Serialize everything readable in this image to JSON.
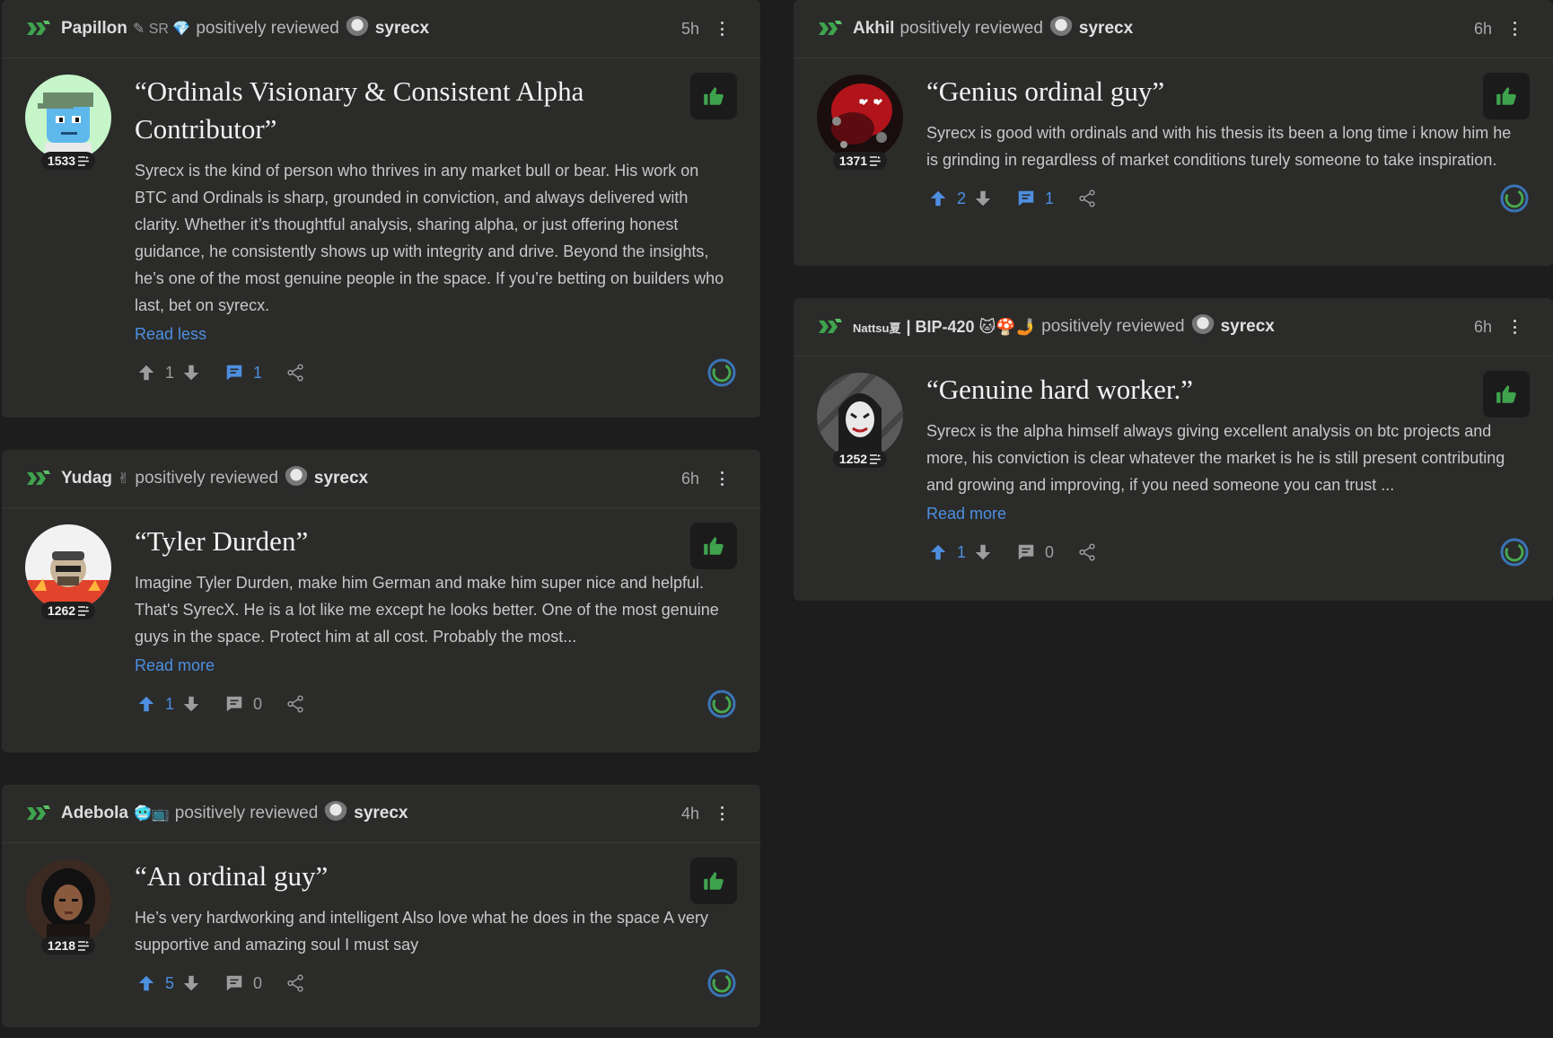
{
  "colors": {
    "page_bg": "#1d1d1d",
    "card_bg": "#2b2b2a",
    "accent_blue": "#4d8fe0",
    "thumb_green": "#3fa34d",
    "brand_green": "#3fa34d"
  },
  "reviews": [
    {
      "reviewer": "Papillon",
      "reviewer_extra": "✎ SR 💎",
      "verb": "positively reviewed",
      "target": "syrecx",
      "time": "5h",
      "score": "1533",
      "title": "“Ordinals Visionary & Consistent Alpha Contributor”",
      "text": "Syrecx is the kind of person who thrives in any market bull or bear. His work on BTC and Ordinals is sharp, grounded in conviction, and always delivered with clarity. Whether it’s thoughtful analysis, sharing alpha, or just offering honest guidance, he consistently shows up with integrity and drive. Beyond the insights, he’s one of the most genuine people in the space. If you’re betting on builders who last, bet on syrecx.",
      "link": "Read less",
      "upvotes": "1",
      "comments": "1"
    },
    {
      "reviewer": "Yudag",
      "reviewer_extra": "✌",
      "verb": "positively reviewed",
      "target": "syrecx",
      "time": "6h",
      "score": "1262",
      "title": "“Tyler Durden”",
      "text": "Imagine Tyler Durden, make him German and make him super nice and helpful. That's SyrecX. He is a lot like me except he looks better. One of the most genuine guys in the space. Protect him at all cost. Probably the most...",
      "link": "Read more",
      "upvotes": "1",
      "comments": "0"
    },
    {
      "reviewer": "Adebola",
      "reviewer_extra": "🥶📺",
      "verb": "positively reviewed",
      "target": "syrecx",
      "time": "4h",
      "score": "1218",
      "title": "“An ordinal guy”",
      "text": "He’s very hardworking and intelligent Also love what he does in the space A very supportive and amazing soul I must say",
      "link": "",
      "upvotes": "5",
      "comments": "0"
    },
    {
      "reviewer": "Akhil",
      "reviewer_extra": "",
      "verb": "positively reviewed",
      "target": "syrecx",
      "time": "6h",
      "score": "1371",
      "title": "“Genius ordinal guy”",
      "text": "Syrecx is good with ordinals and with his thesis its been a long time i know him he is grinding in regardless of market conditions turely someone to take inspiration.",
      "link": "",
      "upvotes": "2",
      "comments": "1"
    },
    {
      "reviewer": "Nattsu夏",
      "reviewer_extra": "| BIP-420 🐱🍄🤳",
      "verb": "positively reviewed",
      "target": "syrecx",
      "time": "6h",
      "score": "1252",
      "title": "“Genuine hard worker.”",
      "text": "Syrecx is the alpha himself always giving excellent analysis on btc projects and more, his conviction is clear whatever the market is he is still present contributing and growing and improving, if you need someone you can trust ...",
      "link": "Read more",
      "upvotes": "1",
      "comments": "0"
    }
  ]
}
